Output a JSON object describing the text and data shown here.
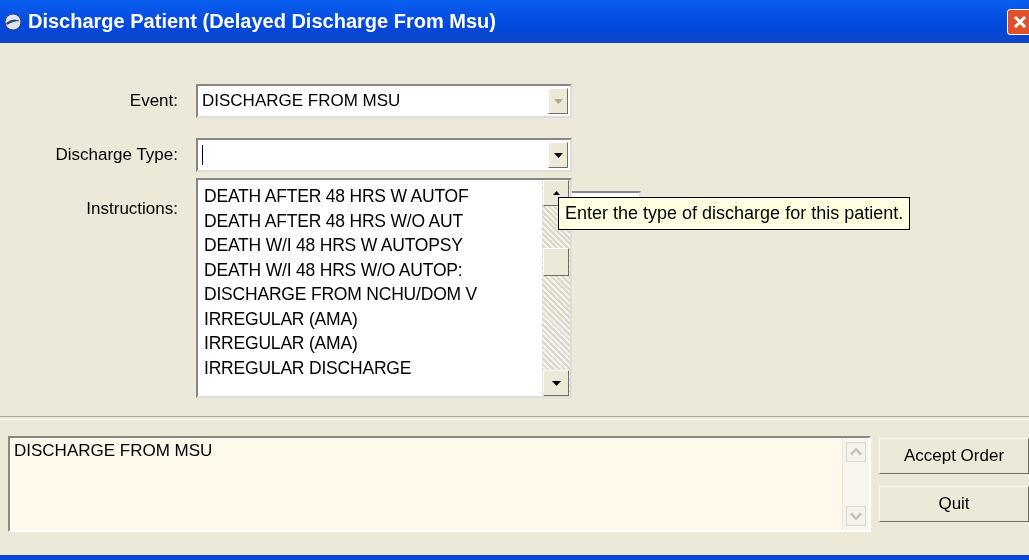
{
  "window": {
    "title": "Discharge Patient (Delayed Discharge From Msu)"
  },
  "fields": [
    {
      "kind": "combo",
      "label": "Event:",
      "value": "DISCHARGE FROM MSU",
      "disabled": true
    },
    {
      "kind": "combo",
      "label": "Discharge Type:",
      "disabled": false
    },
    {
      "kind": "text",
      "label": "Instructions:"
    }
  ],
  "dropdown": {
    "items": [
      "DEATH AFTER 48 HRS W AUTOF",
      "DEATH AFTER 48 HRS W/O AUT",
      "DEATH W/I 48 HRS W AUTOPSY",
      "DEATH W/I 48 HRS W/O AUTOP:",
      "DISCHARGE FROM NCHU/DOM V",
      "IRREGULAR (AMA)",
      "IRREGULAR (AMA)",
      "IRREGULAR DISCHARGE"
    ]
  },
  "tooltip": "Enter the type of discharge for this patient.",
  "order_text": "DISCHARGE FROM MSU",
  "buttons": [
    "Accept Order",
    "Quit"
  ]
}
